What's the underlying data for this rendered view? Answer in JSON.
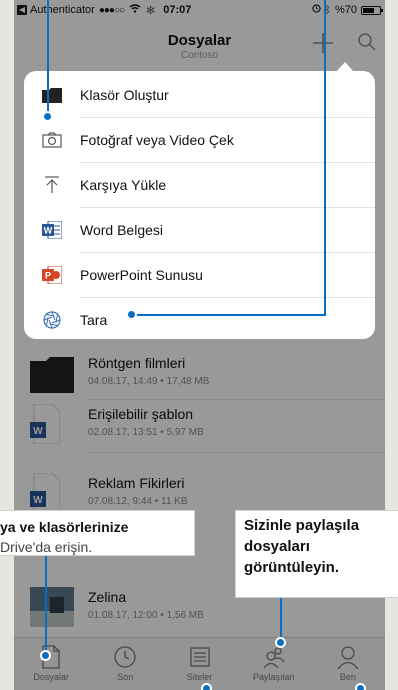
{
  "status_bar": {
    "back_app": "Authenticator",
    "signal": "●●●○○",
    "time": "07:07",
    "battery": "%70",
    "battery_level": 0.7
  },
  "nav": {
    "title": "Dosyalar",
    "subtitle": "Contoso"
  },
  "menu": {
    "items": [
      {
        "label": "Klasör Oluştur",
        "icon": "folder-icon"
      },
      {
        "label": "Fotoğraf veya Video Çek",
        "icon": "camera-icon"
      },
      {
        "label": "Karşıya Yükle",
        "icon": "upload-icon"
      },
      {
        "label": "Word Belgesi",
        "icon": "word-icon"
      },
      {
        "label": "PowerPoint Sunusu",
        "icon": "powerpoint-icon"
      },
      {
        "label": "Tara",
        "icon": "scan-icon"
      }
    ]
  },
  "files": [
    {
      "name": "Röntgen filmleri",
      "meta": "04.08.17, 14:49 • 17,48 MB",
      "type": "folder"
    },
    {
      "name": "Erişilebilir şablon",
      "meta": "02.08.17, 13:51 • 5,97 MB",
      "type": "word"
    },
    {
      "name": "Reklam Fikirleri",
      "meta": "07.08.12, 9:44 • 11 KB",
      "type": "word"
    },
    {
      "name": "Zelina",
      "meta": "01.08.17, 12:00 • 1,56 MB",
      "type": "image"
    }
  ],
  "tabs": [
    {
      "label": "Dosyalar",
      "icon": "document-icon"
    },
    {
      "label": "Son",
      "icon": "clock-icon"
    },
    {
      "label": "Siteler",
      "icon": "sites-icon"
    },
    {
      "label": "Paylaşılan",
      "icon": "shared-icon"
    },
    {
      "label": "Ben",
      "icon": "person-icon"
    }
  ],
  "callouts": {
    "left_bold": "ya ve klasörlerinize",
    "left_light": "Drive'da erişin.",
    "right_text": "Sizinle paylaşıla dosyaları görüntüleyin."
  },
  "colors": {
    "accent": "#0a6fc2",
    "word_blue": "#2b579a",
    "powerpoint_orange": "#d24726"
  }
}
